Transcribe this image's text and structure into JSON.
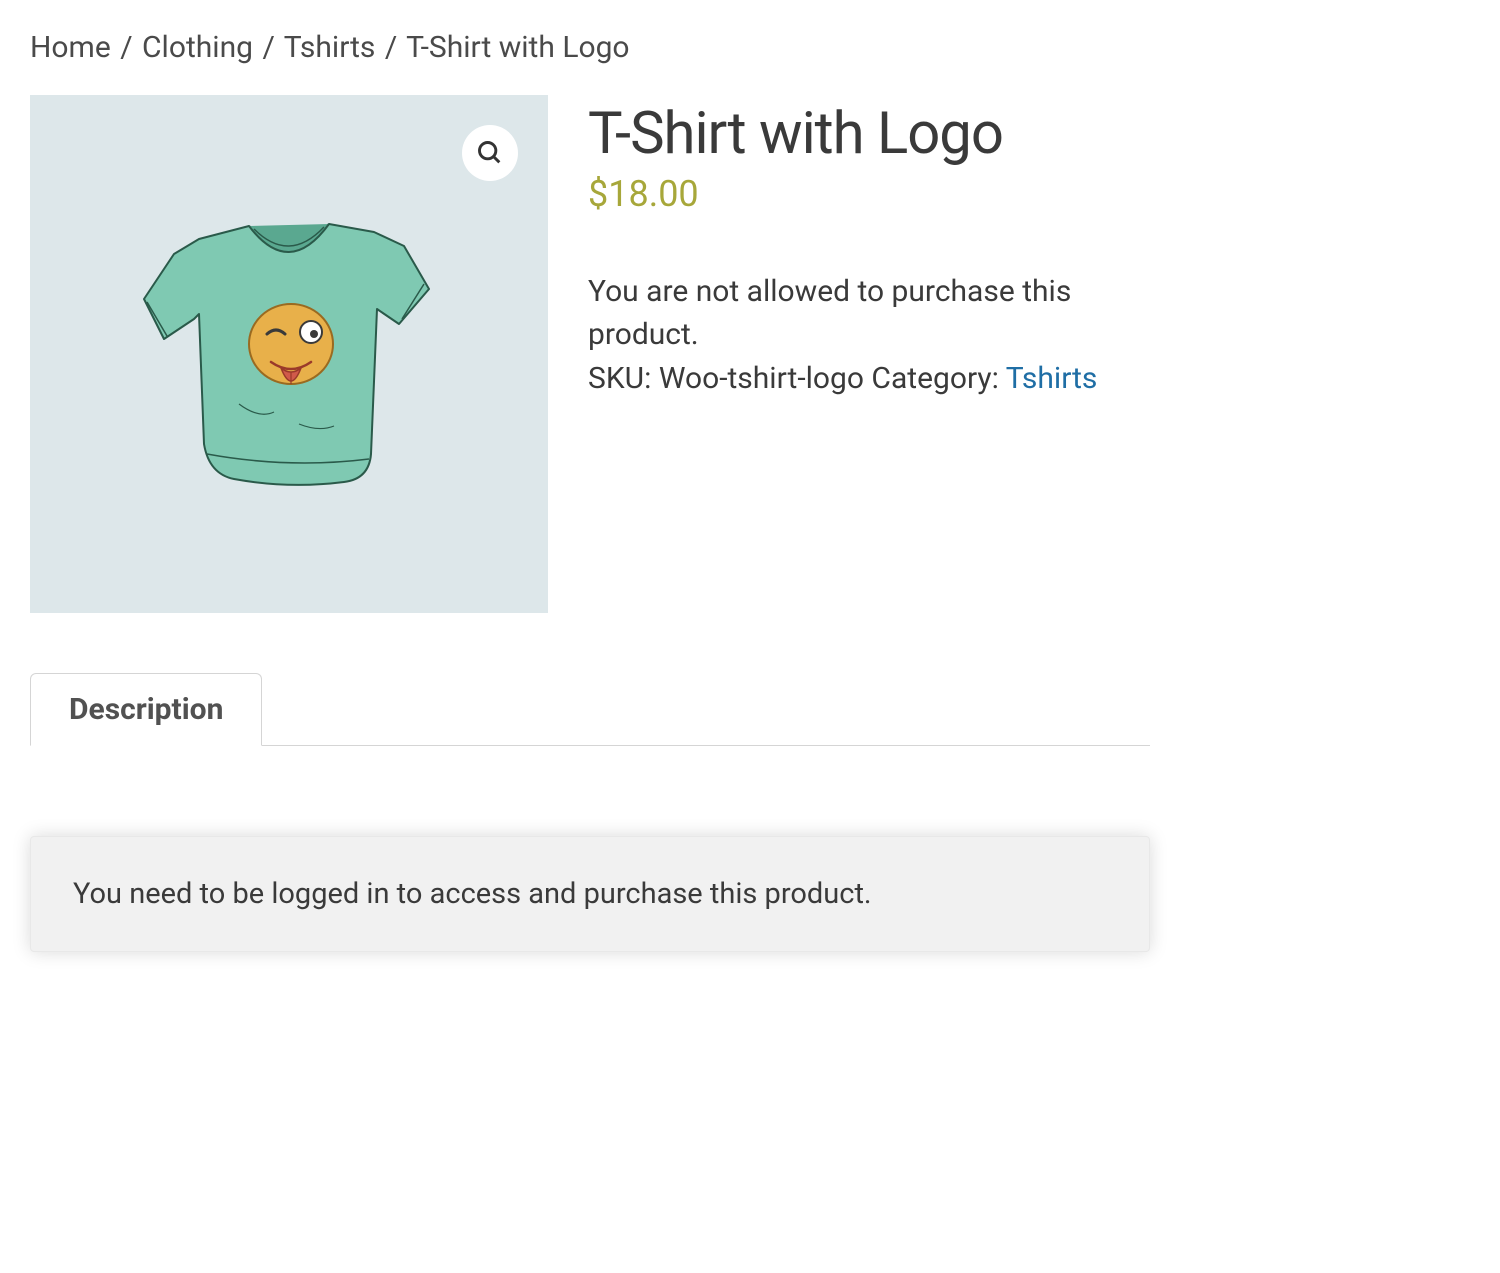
{
  "breadcrumb": {
    "home": "Home",
    "sep": "/",
    "clothing": "Clothing",
    "tshirts": "Tshirts",
    "current": "T-Shirt with Logo"
  },
  "product": {
    "title": "T-Shirt with Logo",
    "price": "$18.00",
    "restriction_notice": "You are not allowed to purchase this product.",
    "sku_label": "SKU:",
    "sku_value": "Woo-tshirt-logo",
    "category_label": "Category:",
    "category_value": "Tshirts"
  },
  "tabs": {
    "description": "Description"
  },
  "login_notice": "You need to be logged in to access and purchase this product."
}
